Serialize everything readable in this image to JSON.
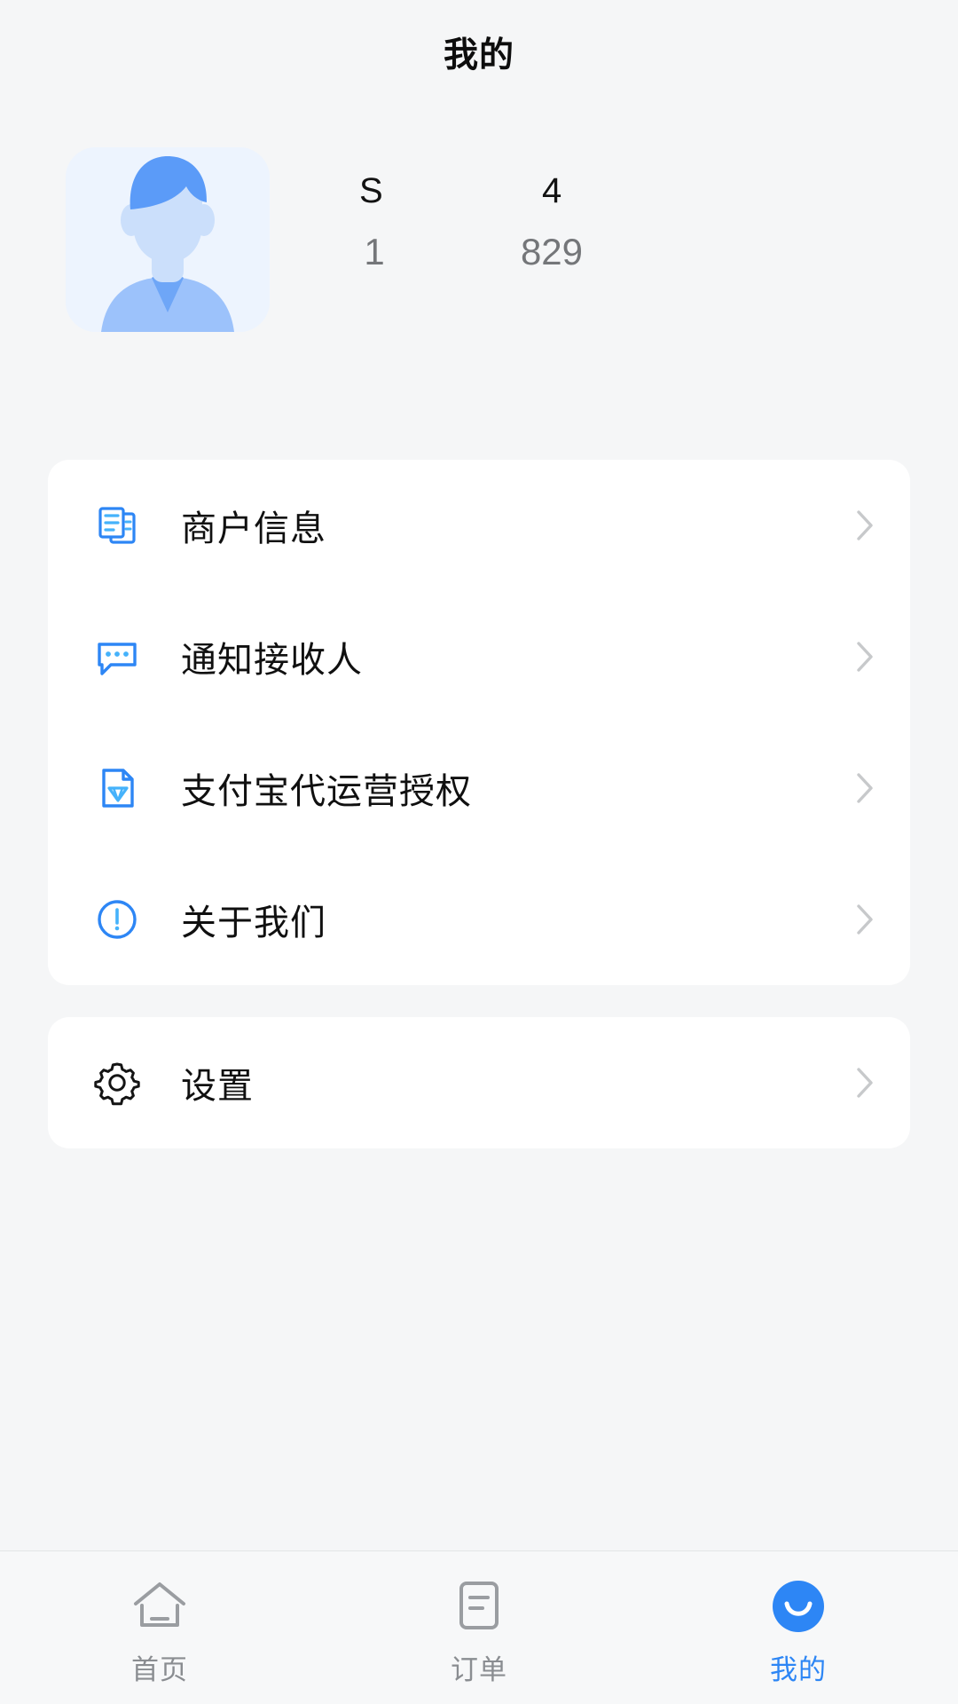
{
  "header": {
    "title": "我的"
  },
  "profile": {
    "avatar_icon": "user-avatar-illustration",
    "stats": [
      {
        "label": "S",
        "value": "1",
        "icon": ""
      },
      {
        "label": "4",
        "value": "829",
        "icon": ""
      }
    ]
  },
  "menu_cards": [
    {
      "rows": [
        {
          "icon": "documents-icon",
          "label": "商户信息",
          "chevron": "chevron-right-icon"
        },
        {
          "icon": "chat-bubble-icon",
          "label": "通知接收人",
          "chevron": "chevron-right-icon"
        },
        {
          "icon": "document-gem-icon",
          "label": "支付宝代运营授权",
          "chevron": "chevron-right-icon"
        },
        {
          "icon": "info-circle-icon",
          "label": "关于我们",
          "chevron": "chevron-right-icon"
        }
      ]
    },
    {
      "rows": [
        {
          "icon": "gear-icon",
          "label": "设置",
          "chevron": "chevron-right-icon"
        }
      ]
    }
  ],
  "tabbar": {
    "tabs": [
      {
        "icon": "home-icon",
        "label": "首页",
        "active": false
      },
      {
        "icon": "receipt-icon",
        "label": "订单",
        "active": false
      },
      {
        "icon": "smiley-icon",
        "label": "我的",
        "active": true
      }
    ]
  },
  "colors": {
    "accent": "#2d86f5",
    "page_bg": "#f5f6f7",
    "card_bg": "#ffffff",
    "text_primary": "#101010",
    "text_muted": "#747679",
    "tab_inactive": "#8a8d91"
  }
}
